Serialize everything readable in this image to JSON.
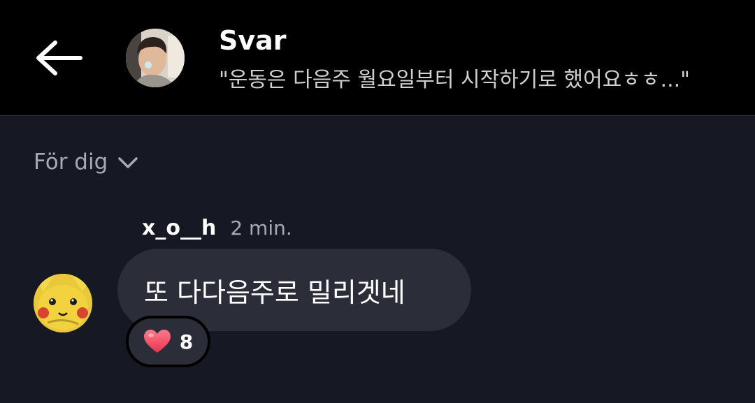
{
  "header": {
    "back_icon": "arrow-left-icon",
    "title": "Svar",
    "subtitle": "\"운동은 다음주 월요일부터 시작하기로 했어요ㅎㅎ...\""
  },
  "filter": {
    "label": "För dig",
    "icon": "chevron-down-icon"
  },
  "comment": {
    "username": "x_o__h",
    "time": "2 min.",
    "text": "또 다다음주로 밀리겟네",
    "reaction": {
      "icon": "heart-icon",
      "count": "8"
    }
  },
  "colors": {
    "background": "#161823",
    "header_background": "#000000",
    "bubble": "#2b2d38",
    "muted_text": "#a8aab3",
    "heart": "#ff4d6d"
  }
}
